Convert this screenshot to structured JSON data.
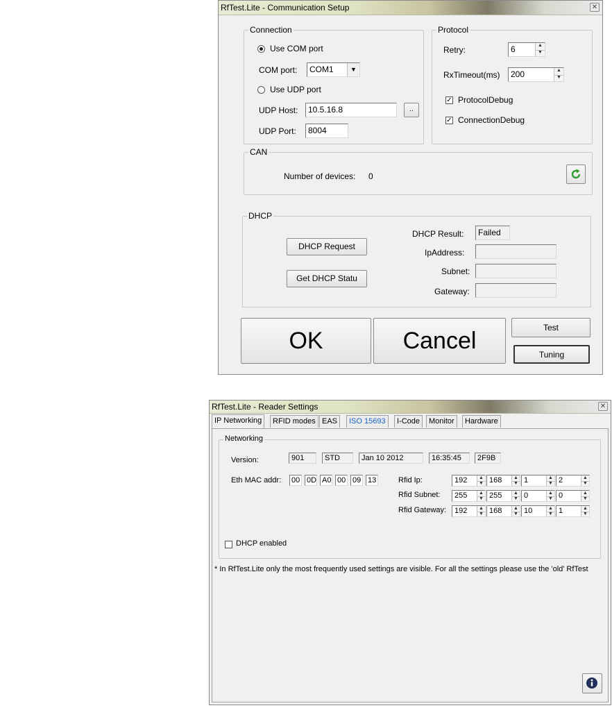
{
  "comm_setup": {
    "title": "RfTest.Lite - Communication Setup",
    "connection": {
      "legend": "Connection",
      "use_com_label": "Use COM port",
      "com_port_label": "COM port:",
      "com_port_value": "COM1",
      "use_udp_label": "Use UDP port",
      "udp_host_label": "UDP Host:",
      "udp_host_value": "10.5.16.8",
      "browse_label": "..",
      "udp_port_label": "UDP Port:",
      "udp_port_value": "8004"
    },
    "protocol": {
      "legend": "Protocol",
      "retry_label": "Retry:",
      "retry_value": "6",
      "rxtimeout_label": "RxTimeout(ms)",
      "rxtimeout_value": "200",
      "protocol_debug_label": "ProtocolDebug",
      "connection_debug_label": "ConnectionDebug"
    },
    "can": {
      "legend": "CAN",
      "devices_label": "Number of devices:",
      "devices_value": "0"
    },
    "dhcp": {
      "legend": "DHCP",
      "request_label": "DHCP Request",
      "status_label": "Get DHCP Statu",
      "result_label": "DHCP Result:",
      "result_value": "Failed",
      "ip_label": "IpAddress:",
      "subnet_label": "Subnet:",
      "gateway_label": "Gateway:"
    },
    "buttons": {
      "ok": "OK",
      "cancel": "Cancel",
      "test": "Test",
      "tuning": "Tuning"
    }
  },
  "reader_settings": {
    "title": "RfTest.Lite - Reader Settings",
    "tabs": [
      "IP Networking",
      "RFID modes",
      "EAS",
      "ISO 15693",
      "I-Code",
      "Monitor",
      "Hardware"
    ],
    "networking": {
      "legend": "Networking",
      "version_label": "Version:",
      "version_values": [
        "901",
        "STD",
        "Jan 10 2012",
        "16:35:45",
        "2F9B"
      ],
      "mac_label": "Eth MAC addr:",
      "mac_values": [
        "00",
        "0D",
        "A0",
        "00",
        "09",
        "13"
      ],
      "rfid_ip_label": "Rfid Ip:",
      "rfid_ip": [
        "192",
        "168",
        "1",
        "2"
      ],
      "rfid_subnet_label": "Rfid Subnet:",
      "rfid_subnet": [
        "255",
        "255",
        "0",
        "0"
      ],
      "rfid_gateway_label": "Rfid Gateway:",
      "rfid_gateway": [
        "192",
        "168",
        "10",
        "1"
      ],
      "dhcp_enabled_label": "DHCP enabled"
    },
    "note": "* In RfTest.Lite only the most frequently used settings are visible. For all the settings please use the 'old' RfTest"
  },
  "icons": {
    "refresh": "refresh-icon",
    "info": "info-icon",
    "close": "close-icon"
  },
  "colors": {
    "refresh_green": "#2e9e2e",
    "tab_link_blue": "#1a63c9"
  }
}
